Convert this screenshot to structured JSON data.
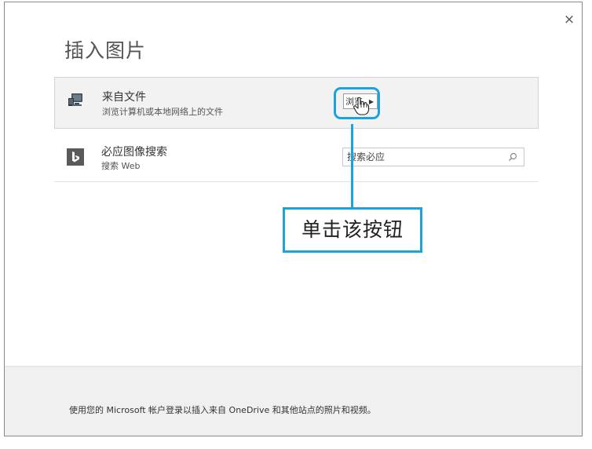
{
  "dialog": {
    "title": "插入图片",
    "close_label": "×"
  },
  "from_file": {
    "title": "来自文件",
    "subtitle": "浏览计算机或本地网络上的文件",
    "browse_label": "浏览",
    "icon": "computer-monitor-icon"
  },
  "bing": {
    "title": "必应图像搜索",
    "subtitle": "搜索 Web",
    "search_placeholder": "搜索必应",
    "icon": "bing-logo-icon"
  },
  "annotation": {
    "callout_text": "单击该按钮",
    "accent_color": "#1aa3dd"
  },
  "footer": {
    "text": "使用您的 Microsoft 帐户登录以插入来自 OneDrive 和其他站点的照片和视频。"
  }
}
